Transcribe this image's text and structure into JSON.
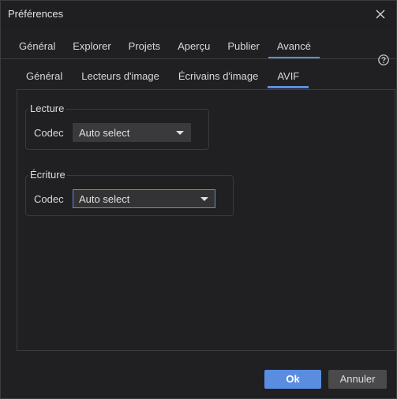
{
  "window": {
    "title": "Préférences"
  },
  "tabs": [
    "Général",
    "Explorer",
    "Projets",
    "Aperçu",
    "Publier",
    "Avancé"
  ],
  "active_tab": "Avancé",
  "subtabs": [
    "Général",
    "Lecteurs d'image",
    "Écrivains d'image",
    "AVIF"
  ],
  "active_subtab": "AVIF",
  "reading": {
    "title": "Lecture",
    "codec_label": "Codec",
    "codec_value": "Auto select"
  },
  "writing": {
    "title": "Écriture",
    "codec_label": "Codec",
    "codec_value": "Auto select"
  },
  "buttons": {
    "ok": "Ok",
    "cancel": "Annuler"
  },
  "colors": {
    "accent": "#5a8de0",
    "background": "#202022"
  },
  "icons": {
    "close": "close-icon",
    "help": "help-icon",
    "dropdown": "chevron-down-icon"
  }
}
